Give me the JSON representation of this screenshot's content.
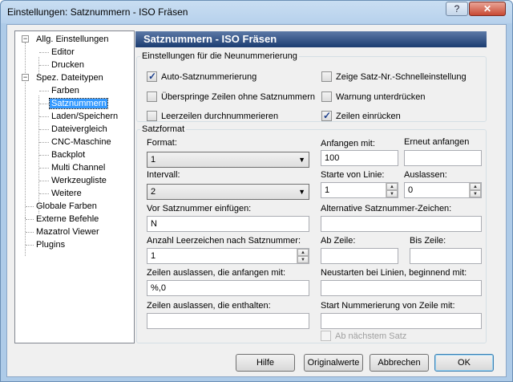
{
  "window": {
    "title": "Einstellungen: Satznummern - ISO Fräsen"
  },
  "titlebar_buttons": {
    "help": "?",
    "close": "✕"
  },
  "tree": [
    {
      "label": "Allg. Einstellungen",
      "level": 0,
      "expander": "−"
    },
    {
      "label": "Editor",
      "level": 1
    },
    {
      "label": "Drucken",
      "level": 1
    },
    {
      "label": "Spez. Dateitypen",
      "level": 0,
      "expander": "−"
    },
    {
      "label": "Farben",
      "level": 1
    },
    {
      "label": "Satznummern",
      "level": 1,
      "selected": true
    },
    {
      "label": "Laden/Speichern",
      "level": 1
    },
    {
      "label": "Dateivergleich",
      "level": 1
    },
    {
      "label": "CNC-Maschine",
      "level": 1
    },
    {
      "label": "Backplot",
      "level": 1
    },
    {
      "label": "Multi Channel",
      "level": 1
    },
    {
      "label": "Werkzeugliste",
      "level": 1
    },
    {
      "label": "Weitere",
      "level": 1
    },
    {
      "label": "Globale Farben",
      "level": 0
    },
    {
      "label": "Externe Befehle",
      "level": 0
    },
    {
      "label": "Mazatrol Viewer",
      "level": 0
    },
    {
      "label": "Plugins",
      "level": 0
    }
  ],
  "page_title": "Satznummern - ISO Fräsen",
  "group1": {
    "title": "Einstellungen für die Neunummerierung",
    "checkboxes": {
      "auto": {
        "label": "Auto-Satznummerierung",
        "checked": true
      },
      "skip": {
        "label": "Überspringe Zeilen ohne Satznummern",
        "checked": false
      },
      "empty": {
        "label": "Leerzeilen durchnummerieren",
        "checked": false
      },
      "quick": {
        "label": "Zeige Satz-Nr.-Schnelleinstellung",
        "checked": false
      },
      "warn": {
        "label": "Warnung unterdrücken",
        "checked": false
      },
      "indent": {
        "label": "Zeilen einrücken",
        "checked": true
      }
    }
  },
  "group2": {
    "title": "Satzformat",
    "format": {
      "label": "Format:",
      "value": "1"
    },
    "interval": {
      "label": "Intervall:",
      "value": "2"
    },
    "start_with": {
      "label": "Anfangen mit:",
      "value": "100"
    },
    "restart": {
      "label": "Erneut anfangen",
      "value": ""
    },
    "start_line": {
      "label": "Starte von Linie:",
      "value": "1"
    },
    "omit": {
      "label": "Auslassen:",
      "value": "0"
    },
    "prefix": {
      "label": "Vor Satznummer einfügen:",
      "value": "N"
    },
    "alt_char": {
      "label": "Alternative Satznummer-Zeichen:",
      "value": ""
    },
    "spaces": {
      "label": "Anzahl Leerzeichen nach Satznummer:",
      "value": "1"
    },
    "from_line": {
      "label": "Ab Zeile:",
      "value": ""
    },
    "to_line": {
      "label": "Bis Zeile:",
      "value": ""
    },
    "skip_start": {
      "label": "Zeilen auslassen, die anfangen mit:",
      "value": "%,0"
    },
    "restart_lines": {
      "label": "Neustarten bei Linien, beginnend mit:",
      "value": ""
    },
    "skip_contain": {
      "label": "Zeilen auslassen, die enthalten:",
      "value": ""
    },
    "start_num_line": {
      "label": "Start Nummerierung von Zeile mit:",
      "value": ""
    },
    "next_block": {
      "label": "Ab nächstem Satz",
      "checked": false
    }
  },
  "buttons": {
    "help": "Hilfe",
    "defaults": "Originalwerte",
    "cancel": "Abbrechen",
    "ok": "OK"
  }
}
